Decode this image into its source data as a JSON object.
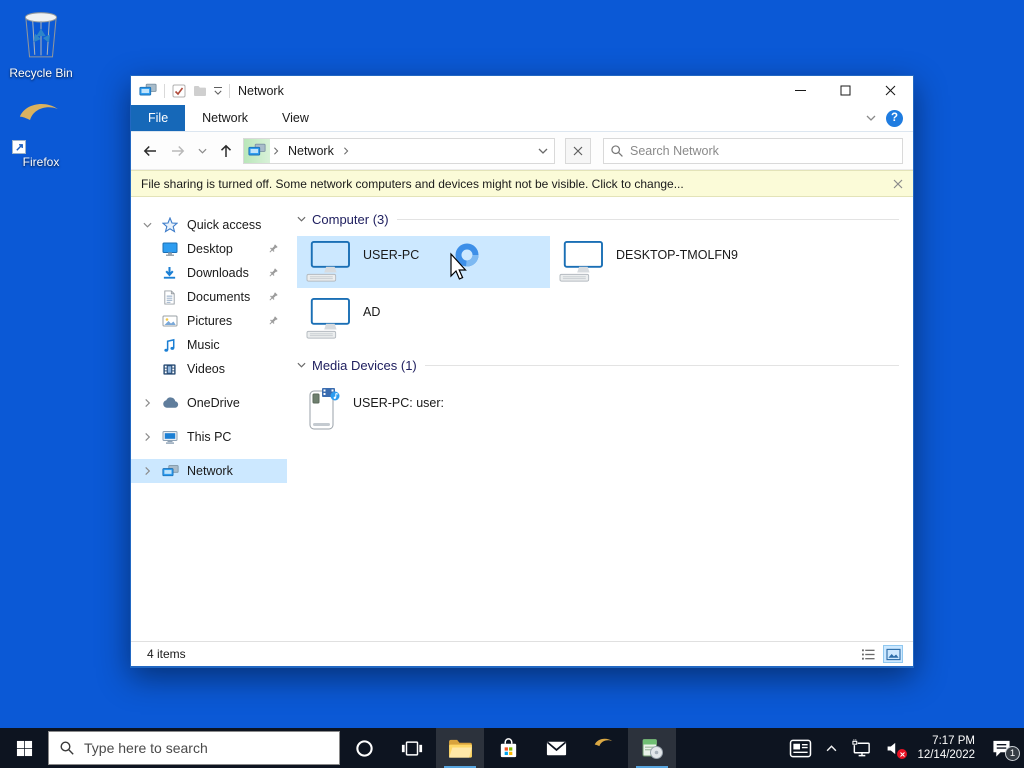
{
  "desktop": {
    "icons": [
      {
        "label": "Recycle Bin"
      },
      {
        "label": "Firefox"
      }
    ]
  },
  "window": {
    "titlebar": {
      "title": "Network"
    },
    "tabs": [
      {
        "label": "File"
      },
      {
        "label": "Network"
      },
      {
        "label": "View"
      }
    ],
    "toolbar": {
      "breadcrumb": "Network",
      "search_placeholder": "Search Network"
    },
    "infobar": {
      "text": "File sharing is turned off. Some network computers and devices might not be visible. Click to change..."
    },
    "sidebar": {
      "items": [
        {
          "label": "Quick access"
        },
        {
          "label": "Desktop"
        },
        {
          "label": "Downloads"
        },
        {
          "label": "Documents"
        },
        {
          "label": "Pictures"
        },
        {
          "label": "Music"
        },
        {
          "label": "Videos"
        },
        {
          "label": "OneDrive"
        },
        {
          "label": "This PC"
        },
        {
          "label": "Network"
        }
      ]
    },
    "content": {
      "groups": [
        {
          "title": "Computer (3)",
          "items": [
            {
              "name": "USER-PC"
            },
            {
              "name": "DESKTOP-TMOLFN9"
            },
            {
              "name": "AD"
            }
          ]
        },
        {
          "title": "Media Devices (1)",
          "items": [
            {
              "name": "USER-PC: user:"
            }
          ]
        }
      ]
    },
    "statusbar": {
      "count": "4 items"
    }
  },
  "taskbar": {
    "search_placeholder": "Type here to search",
    "clock": {
      "time": "7:17 PM",
      "date": "12/14/2022"
    },
    "notification_count": "1"
  },
  "icons": {
    "help_glyph": "?"
  },
  "colors": {
    "desktop_background": "#0b59d6",
    "file_tab_blue": "#1668b8",
    "selection_blue": "#cce8ff",
    "infobar_yellow": "#fbfbd8",
    "taskbar_dark": "#0d1420",
    "accent_underline": "#58a6e0"
  }
}
